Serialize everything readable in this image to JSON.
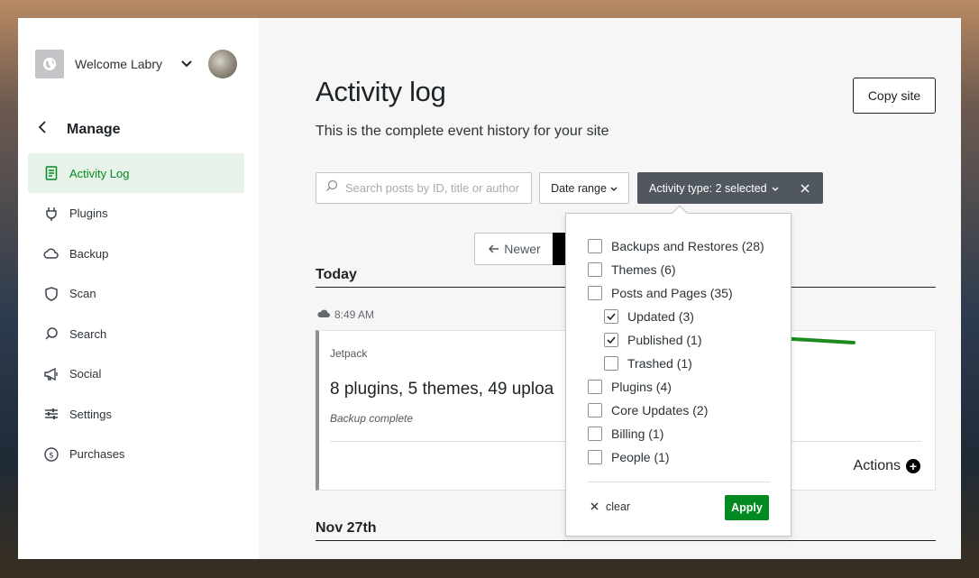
{
  "sidebar": {
    "site_name": "Welcome Labry",
    "manage_label": "Manage",
    "items": [
      {
        "label": "Activity Log",
        "icon": "document-icon",
        "active": true
      },
      {
        "label": "Plugins",
        "icon": "plug-icon"
      },
      {
        "label": "Backup",
        "icon": "cloud-icon"
      },
      {
        "label": "Scan",
        "icon": "shield-icon"
      },
      {
        "label": "Search",
        "icon": "search-icon"
      },
      {
        "label": "Social",
        "icon": "megaphone-icon"
      },
      {
        "label": "Settings",
        "icon": "sliders-icon"
      },
      {
        "label": "Purchases",
        "icon": "dollar-icon"
      }
    ]
  },
  "header": {
    "title": "Activity log",
    "subtitle": "This is the complete event history for your site",
    "copy_site_label": "Copy site"
  },
  "filters": {
    "search_placeholder": "Search posts by ID, title or author",
    "date_range_label": "Date range",
    "activity_type_label": "Activity type: 2 selected"
  },
  "pagination": {
    "newer_label": "Newer"
  },
  "log": {
    "today_heading": "Today",
    "time": "8:49 AM",
    "card": {
      "source": "Jetpack",
      "title": "8 plugins, 5 themes, 49 uploa",
      "subtitle": "Backup complete",
      "actions_label": "Actions"
    },
    "next_heading": "Nov 27th"
  },
  "dropdown": {
    "options": [
      {
        "label": "Backups and Restores (28)",
        "checked": false,
        "indent": false
      },
      {
        "label": "Themes (6)",
        "checked": false,
        "indent": false
      },
      {
        "label": "Posts and Pages (35)",
        "checked": false,
        "indent": false
      },
      {
        "label": "Updated (3)",
        "checked": true,
        "indent": true
      },
      {
        "label": "Published (1)",
        "checked": true,
        "indent": true
      },
      {
        "label": "Trashed (1)",
        "checked": false,
        "indent": true
      },
      {
        "label": "Plugins (4)",
        "checked": false,
        "indent": false
      },
      {
        "label": "Core Updates (2)",
        "checked": false,
        "indent": false
      },
      {
        "label": "Billing (1)",
        "checked": false,
        "indent": false
      },
      {
        "label": "People (1)",
        "checked": false,
        "indent": false
      }
    ],
    "clear_label": "clear",
    "apply_label": "Apply"
  },
  "colors": {
    "accent_green": "#008a20",
    "active_bg": "#e7f2e9",
    "annotation_arrow": "#1e8a1e",
    "dark_button": "#50575e"
  }
}
